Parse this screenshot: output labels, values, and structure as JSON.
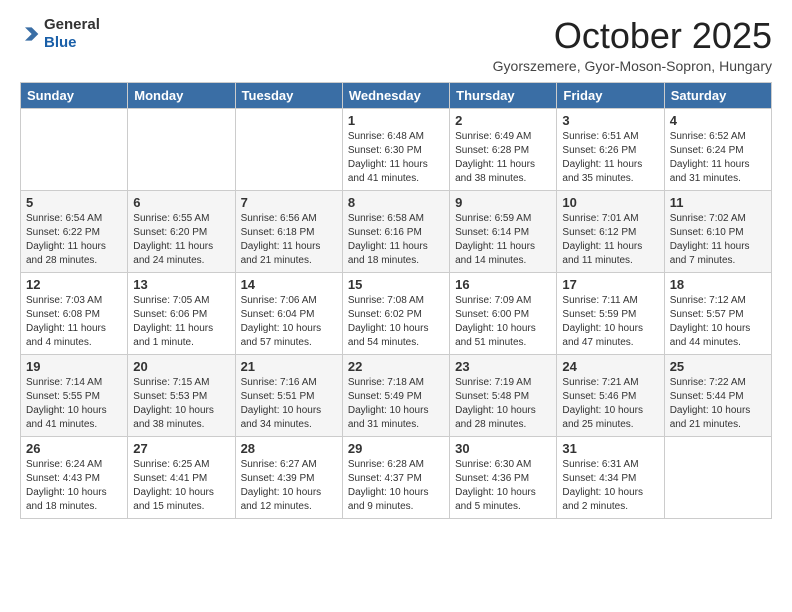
{
  "header": {
    "logo_general": "General",
    "logo_blue": "Blue",
    "month_title": "October 2025",
    "subtitle": "Gyorszemere, Gyor-Moson-Sopron, Hungary"
  },
  "calendar": {
    "days_of_week": [
      "Sunday",
      "Monday",
      "Tuesday",
      "Wednesday",
      "Thursday",
      "Friday",
      "Saturday"
    ],
    "weeks": [
      [
        {
          "date": "",
          "info": ""
        },
        {
          "date": "",
          "info": ""
        },
        {
          "date": "",
          "info": ""
        },
        {
          "date": "1",
          "info": "Sunrise: 6:48 AM\nSunset: 6:30 PM\nDaylight: 11 hours\nand 41 minutes."
        },
        {
          "date": "2",
          "info": "Sunrise: 6:49 AM\nSunset: 6:28 PM\nDaylight: 11 hours\nand 38 minutes."
        },
        {
          "date": "3",
          "info": "Sunrise: 6:51 AM\nSunset: 6:26 PM\nDaylight: 11 hours\nand 35 minutes."
        },
        {
          "date": "4",
          "info": "Sunrise: 6:52 AM\nSunset: 6:24 PM\nDaylight: 11 hours\nand 31 minutes."
        }
      ],
      [
        {
          "date": "5",
          "info": "Sunrise: 6:54 AM\nSunset: 6:22 PM\nDaylight: 11 hours\nand 28 minutes."
        },
        {
          "date": "6",
          "info": "Sunrise: 6:55 AM\nSunset: 6:20 PM\nDaylight: 11 hours\nand 24 minutes."
        },
        {
          "date": "7",
          "info": "Sunrise: 6:56 AM\nSunset: 6:18 PM\nDaylight: 11 hours\nand 21 minutes."
        },
        {
          "date": "8",
          "info": "Sunrise: 6:58 AM\nSunset: 6:16 PM\nDaylight: 11 hours\nand 18 minutes."
        },
        {
          "date": "9",
          "info": "Sunrise: 6:59 AM\nSunset: 6:14 PM\nDaylight: 11 hours\nand 14 minutes."
        },
        {
          "date": "10",
          "info": "Sunrise: 7:01 AM\nSunset: 6:12 PM\nDaylight: 11 hours\nand 11 minutes."
        },
        {
          "date": "11",
          "info": "Sunrise: 7:02 AM\nSunset: 6:10 PM\nDaylight: 11 hours\nand 7 minutes."
        }
      ],
      [
        {
          "date": "12",
          "info": "Sunrise: 7:03 AM\nSunset: 6:08 PM\nDaylight: 11 hours\nand 4 minutes."
        },
        {
          "date": "13",
          "info": "Sunrise: 7:05 AM\nSunset: 6:06 PM\nDaylight: 11 hours\nand 1 minute."
        },
        {
          "date": "14",
          "info": "Sunrise: 7:06 AM\nSunset: 6:04 PM\nDaylight: 10 hours\nand 57 minutes."
        },
        {
          "date": "15",
          "info": "Sunrise: 7:08 AM\nSunset: 6:02 PM\nDaylight: 10 hours\nand 54 minutes."
        },
        {
          "date": "16",
          "info": "Sunrise: 7:09 AM\nSunset: 6:00 PM\nDaylight: 10 hours\nand 51 minutes."
        },
        {
          "date": "17",
          "info": "Sunrise: 7:11 AM\nSunset: 5:59 PM\nDaylight: 10 hours\nand 47 minutes."
        },
        {
          "date": "18",
          "info": "Sunrise: 7:12 AM\nSunset: 5:57 PM\nDaylight: 10 hours\nand 44 minutes."
        }
      ],
      [
        {
          "date": "19",
          "info": "Sunrise: 7:14 AM\nSunset: 5:55 PM\nDaylight: 10 hours\nand 41 minutes."
        },
        {
          "date": "20",
          "info": "Sunrise: 7:15 AM\nSunset: 5:53 PM\nDaylight: 10 hours\nand 38 minutes."
        },
        {
          "date": "21",
          "info": "Sunrise: 7:16 AM\nSunset: 5:51 PM\nDaylight: 10 hours\nand 34 minutes."
        },
        {
          "date": "22",
          "info": "Sunrise: 7:18 AM\nSunset: 5:49 PM\nDaylight: 10 hours\nand 31 minutes."
        },
        {
          "date": "23",
          "info": "Sunrise: 7:19 AM\nSunset: 5:48 PM\nDaylight: 10 hours\nand 28 minutes."
        },
        {
          "date": "24",
          "info": "Sunrise: 7:21 AM\nSunset: 5:46 PM\nDaylight: 10 hours\nand 25 minutes."
        },
        {
          "date": "25",
          "info": "Sunrise: 7:22 AM\nSunset: 5:44 PM\nDaylight: 10 hours\nand 21 minutes."
        }
      ],
      [
        {
          "date": "26",
          "info": "Sunrise: 6:24 AM\nSunset: 4:43 PM\nDaylight: 10 hours\nand 18 minutes."
        },
        {
          "date": "27",
          "info": "Sunrise: 6:25 AM\nSunset: 4:41 PM\nDaylight: 10 hours\nand 15 minutes."
        },
        {
          "date": "28",
          "info": "Sunrise: 6:27 AM\nSunset: 4:39 PM\nDaylight: 10 hours\nand 12 minutes."
        },
        {
          "date": "29",
          "info": "Sunrise: 6:28 AM\nSunset: 4:37 PM\nDaylight: 10 hours\nand 9 minutes."
        },
        {
          "date": "30",
          "info": "Sunrise: 6:30 AM\nSunset: 4:36 PM\nDaylight: 10 hours\nand 5 minutes."
        },
        {
          "date": "31",
          "info": "Sunrise: 6:31 AM\nSunset: 4:34 PM\nDaylight: 10 hours\nand 2 minutes."
        },
        {
          "date": "",
          "info": ""
        }
      ]
    ]
  }
}
